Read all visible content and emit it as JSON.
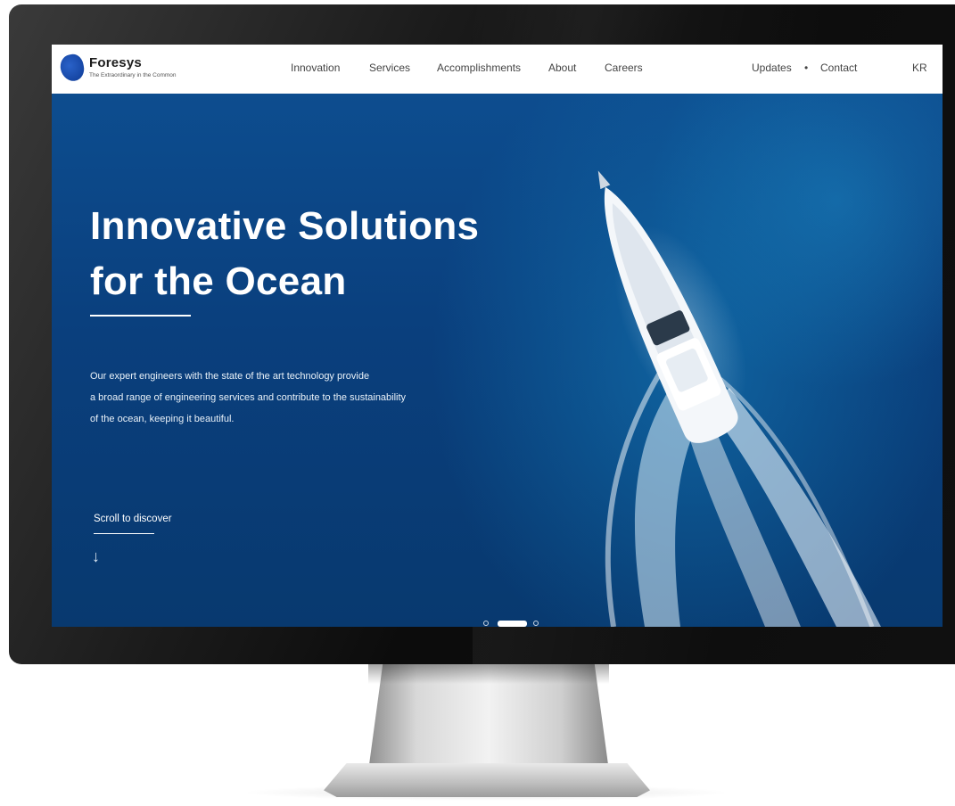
{
  "brand": {
    "name": "Foresys",
    "tagline": "The Extraordinary in the Common"
  },
  "nav": {
    "items": [
      "Innovation",
      "Services",
      "Accomplishments",
      "About",
      "Careers"
    ],
    "updates": "Updates",
    "separator": "•",
    "contact": "Contact",
    "lang": "KR"
  },
  "hero": {
    "title_line1": "Innovative Solutions",
    "title_line2": "for the Ocean",
    "desc": [
      "Our expert engineers with the state of the art technology provide",
      "a broad range of engineering services and contribute to the sustainability",
      "of the ocean, keeping it beautiful."
    ],
    "scroll_label": "Scroll to discover",
    "scroll_arrow": "↓"
  },
  "slider": {
    "active_index": 1,
    "count": 3
  },
  "icons": {
    "logo": "foresys-logo-icon",
    "arrow": "arrow-down-icon"
  },
  "colors": {
    "ocean": "#0a3f78",
    "header_bg": "#ffffff",
    "text_light": "#ffffff",
    "brand_blue": "#1a4fb5"
  }
}
